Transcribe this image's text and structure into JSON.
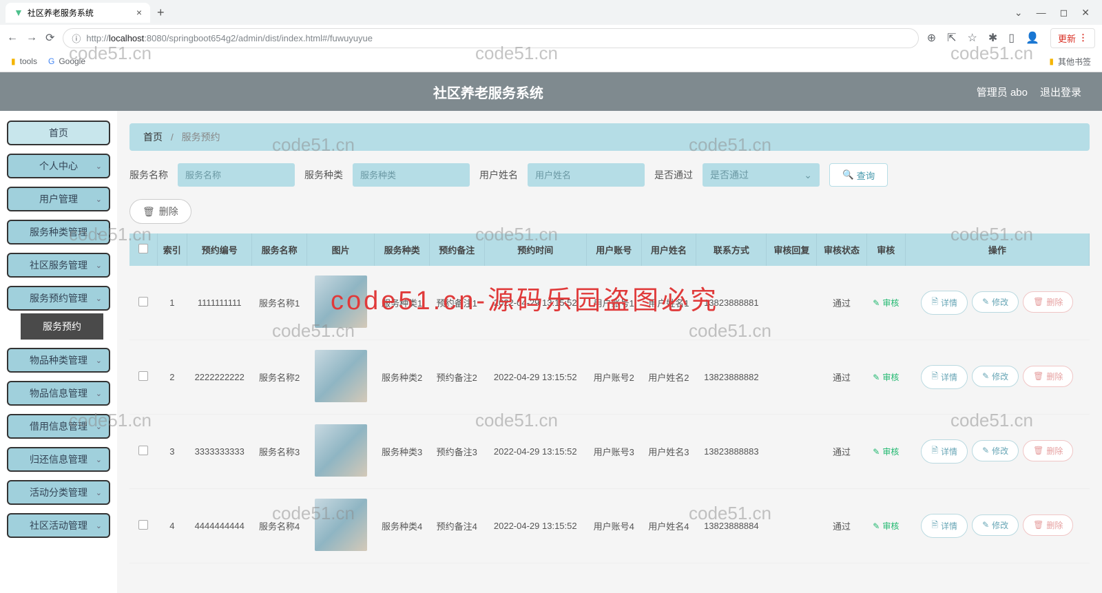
{
  "browser": {
    "tab_title": "社区养老服务系统",
    "url_prefix": "http://",
    "url_host": "localhost",
    "url_port": ":8080",
    "url_path": "/springboot654g2/admin/dist/index.html#/fuwuyuyue",
    "update_label": "更新",
    "bookmarks": {
      "tools": "tools",
      "google": "Google",
      "other": "其他书签"
    }
  },
  "header": {
    "title": "社区养老服务系统",
    "user_label": "管理员 abo",
    "logout": "退出登录"
  },
  "sidebar": {
    "items": [
      "首页",
      "个人中心",
      "用户管理",
      "服务种类管理",
      "社区服务管理",
      "服务预约管理",
      "物品种类管理",
      "物品信息管理",
      "借用信息管理",
      "归还信息管理",
      "活动分类管理",
      "社区活动管理"
    ],
    "sub_active": "服务预约"
  },
  "breadcrumb": {
    "home": "首页",
    "current": "服务预约"
  },
  "filters": {
    "name_label": "服务名称",
    "name_ph": "服务名称",
    "kind_label": "服务种类",
    "kind_ph": "服务种类",
    "user_label": "用户姓名",
    "user_ph": "用户姓名",
    "pass_label": "是否通过",
    "pass_ph": "是否通过",
    "search": "查询"
  },
  "batch_delete": "删除",
  "table": {
    "headers": [
      "",
      "索引",
      "预约编号",
      "服务名称",
      "图片",
      "服务种类",
      "预约备注",
      "预约时间",
      "用户账号",
      "用户姓名",
      "联系方式",
      "审核回复",
      "审核状态",
      "审核",
      "操作"
    ],
    "op_detail": "详情",
    "op_edit": "修改",
    "op_delete": "删除",
    "audit": "审核",
    "rows": [
      {
        "idx": "1",
        "no": "1111111111",
        "name": "服务名称1",
        "kind": "服务种类1",
        "note": "预约备注1",
        "time": "2022-04-29 13:15:52",
        "acct": "用户账号1",
        "uname": "用户姓名1",
        "phone": "13823888881",
        "reply": "",
        "status": "通过"
      },
      {
        "idx": "2",
        "no": "2222222222",
        "name": "服务名称2",
        "kind": "服务种类2",
        "note": "预约备注2",
        "time": "2022-04-29 13:15:52",
        "acct": "用户账号2",
        "uname": "用户姓名2",
        "phone": "13823888882",
        "reply": "",
        "status": "通过"
      },
      {
        "idx": "3",
        "no": "3333333333",
        "name": "服务名称3",
        "kind": "服务种类3",
        "note": "预约备注3",
        "time": "2022-04-29 13:15:52",
        "acct": "用户账号3",
        "uname": "用户姓名3",
        "phone": "13823888883",
        "reply": "",
        "status": "通过"
      },
      {
        "idx": "4",
        "no": "4444444444",
        "name": "服务名称4",
        "kind": "服务种类4",
        "note": "预约备注4",
        "time": "2022-04-29 13:15:52",
        "acct": "用户账号4",
        "uname": "用户姓名4",
        "phone": "13823888884",
        "reply": "",
        "status": "通过"
      }
    ]
  },
  "watermarks": {
    "text": "code51.cn",
    "red": "code51.cn-源码乐园盗图必究"
  }
}
